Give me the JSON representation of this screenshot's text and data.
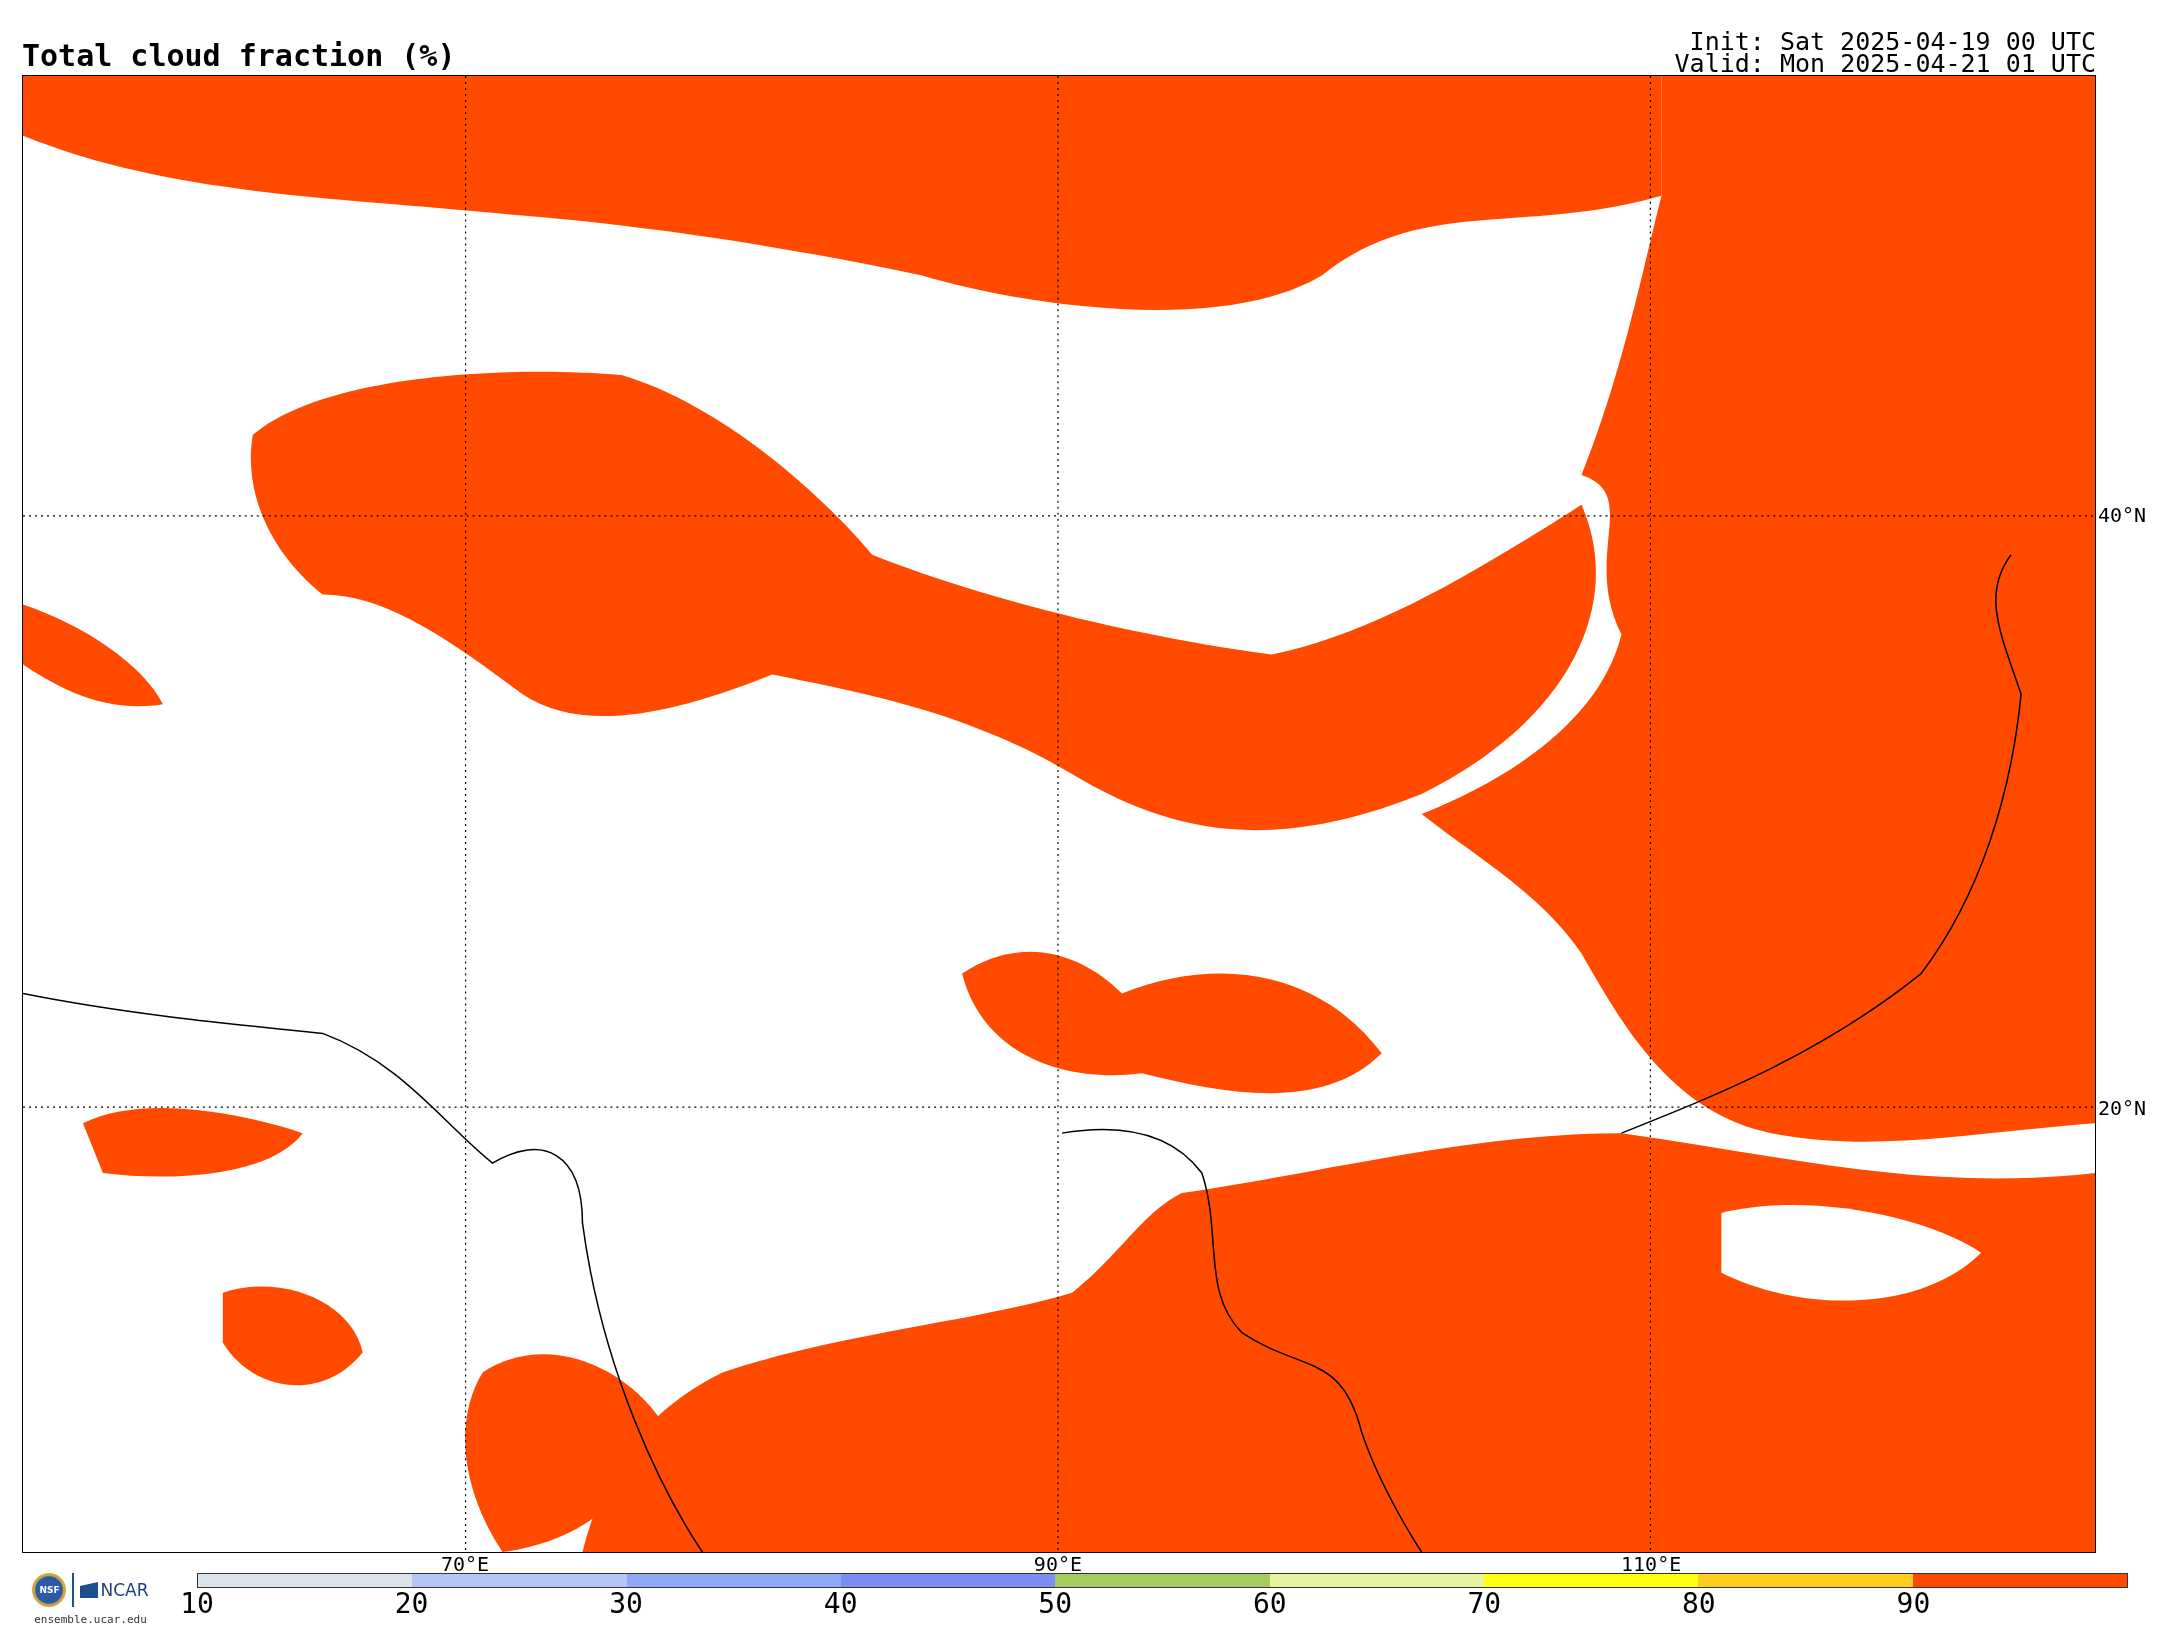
{
  "title": "Total cloud fraction (%)",
  "init": "Init: Sat 2025-04-19 00 UTC",
  "valid": "Valid: Mon 2025-04-21 01 UTC",
  "map": {
    "longitude_labels": [
      "70°E",
      "90°E",
      "110°E"
    ],
    "latitude_labels": [
      "40°N",
      "20°N"
    ]
  },
  "logos": {
    "seal": "NSF",
    "wordmark": "NCAR",
    "site": "ensemble.ucar.edu"
  },
  "colorbar": {
    "segments": [
      {
        "color": "#dbe4ec"
      },
      {
        "color": "#b3c6f7"
      },
      {
        "color": "#8eaaf7"
      },
      {
        "color": "#7b8ff2"
      },
      {
        "color": "#a6cc60"
      },
      {
        "color": "#e8f3a0"
      },
      {
        "color": "#ffff10"
      },
      {
        "color": "#ffcc22"
      },
      {
        "color": "#ff4a00"
      }
    ],
    "tick_labels": [
      "10",
      "20",
      "30",
      "40",
      "50",
      "60",
      "70",
      "80",
      "90"
    ]
  }
}
